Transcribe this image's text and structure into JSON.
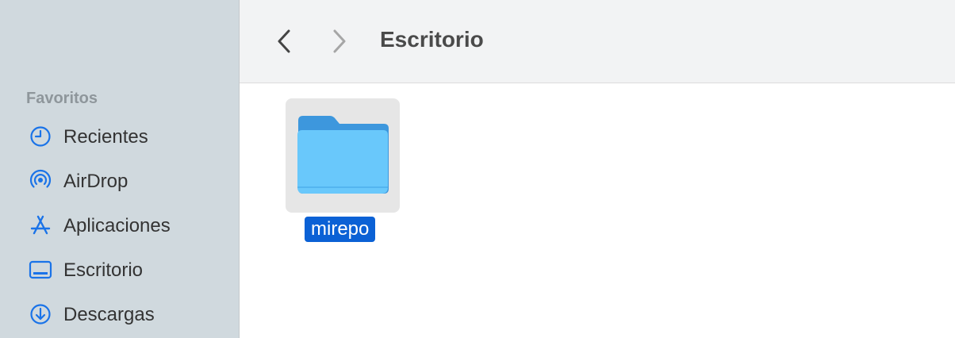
{
  "toolbar": {
    "title": "Escritorio",
    "back_icon": "chevron-left-icon",
    "forward_icon": "chevron-right-icon"
  },
  "sidebar": {
    "section_title": "Favoritos",
    "items": [
      {
        "label": "Recientes",
        "icon": "clock-icon"
      },
      {
        "label": "AirDrop",
        "icon": "airdrop-icon"
      },
      {
        "label": "Aplicaciones",
        "icon": "applications-icon"
      },
      {
        "label": "Escritorio",
        "icon": "desktop-icon"
      },
      {
        "label": "Descargas",
        "icon": "downloads-icon"
      }
    ]
  },
  "content": {
    "items": [
      {
        "name": "mirepo",
        "type": "folder",
        "selected": true
      }
    ]
  },
  "colors": {
    "accent": "#0b61d5",
    "icon_blue": "#1a73e8",
    "folder_front": "#69c8fb",
    "folder_back": "#3d97dd",
    "sidebar_bg": "#d0d9de"
  }
}
